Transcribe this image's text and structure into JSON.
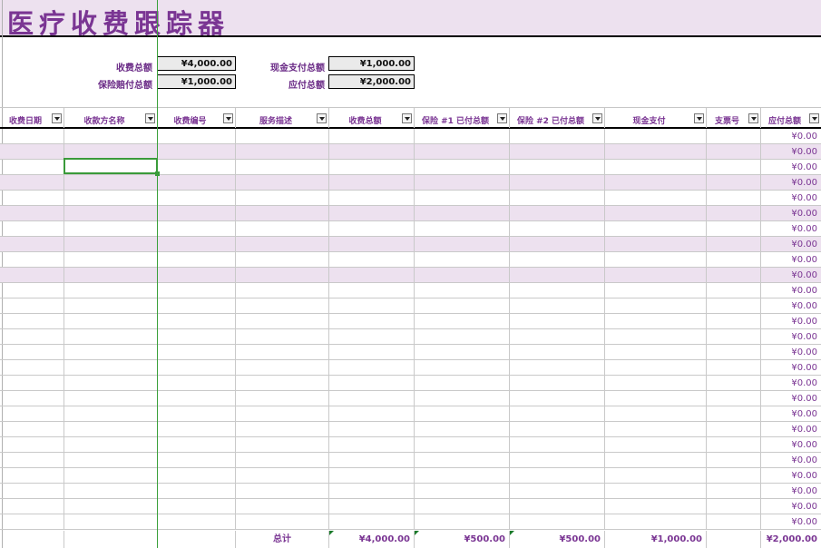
{
  "title": "医疗收费跟踪器",
  "summary": {
    "total_charges_label": "收费总额",
    "total_charges_value": "¥4,000.00",
    "insurance_paid_label": "保险赔付总额",
    "insurance_paid_value": "¥1,000.00",
    "cash_paid_label": "现金支付总额",
    "cash_paid_value": "¥1,000.00",
    "due_label": "应付总额",
    "due_value": "¥2,000.00"
  },
  "columns": [
    {
      "label": "收费日期"
    },
    {
      "label": "收款方名称"
    },
    {
      "label": "收费编号"
    },
    {
      "label": "服务描述"
    },
    {
      "label": "收费总额"
    },
    {
      "label": "保险 #1 已付总额"
    },
    {
      "label": "保险 #2 已付总额"
    },
    {
      "label": "现金支付"
    },
    {
      "label": "支票号"
    },
    {
      "label": "应付总额"
    }
  ],
  "row_amount": "¥0.00",
  "row_count": 26,
  "totals": {
    "label": "总计",
    "charges": "¥4,000.00",
    "ins1": "¥500.00",
    "ins2": "¥500.00",
    "cash": "¥1,000.00",
    "due": "¥2,000.00"
  },
  "colors": {
    "accent": "#7a3593",
    "band": "#ede1ef",
    "selection": "#3a9a3a"
  }
}
